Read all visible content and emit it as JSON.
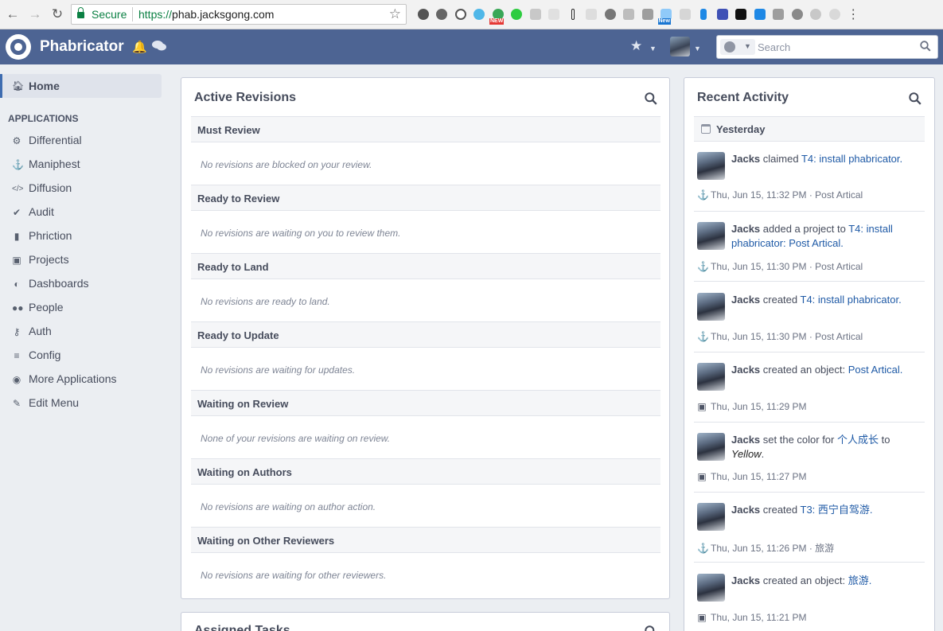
{
  "browser": {
    "secure_label": "Secure",
    "url_protocol": "https://",
    "url_host": "phab.jacksgong.com",
    "extension_badges": [
      "NEW",
      "New"
    ]
  },
  "topbar": {
    "app_name": "Phabricator",
    "search_placeholder": "Search",
    "brand_color": "#4d6493"
  },
  "sidebar": {
    "home_label": "Home",
    "applications_header": "APPLICATIONS",
    "items": [
      {
        "label": "Differential",
        "icon": "gear-icon"
      },
      {
        "label": "Maniphest",
        "icon": "anchor-icon"
      },
      {
        "label": "Diffusion",
        "icon": "code-icon"
      },
      {
        "label": "Audit",
        "icon": "check-circle-icon"
      },
      {
        "label": "Phriction",
        "icon": "book-icon"
      },
      {
        "label": "Projects",
        "icon": "briefcase-icon"
      },
      {
        "label": "Dashboards",
        "icon": "dashboard-icon"
      },
      {
        "label": "People",
        "icon": "users-icon"
      },
      {
        "label": "Auth",
        "icon": "key-icon"
      },
      {
        "label": "Config",
        "icon": "sliders-icon"
      },
      {
        "label": "More Applications",
        "icon": "globe-icon"
      },
      {
        "label": "Edit Menu",
        "icon": "pencil-icon"
      }
    ]
  },
  "active_revisions": {
    "title": "Active Revisions",
    "sections": [
      {
        "header": "Must Review",
        "empty": "No revisions are blocked on your review."
      },
      {
        "header": "Ready to Review",
        "empty": "No revisions are waiting on you to review them."
      },
      {
        "header": "Ready to Land",
        "empty": "No revisions are ready to land."
      },
      {
        "header": "Ready to Update",
        "empty": "No revisions are waiting for updates."
      },
      {
        "header": "Waiting on Review",
        "empty": "None of your revisions are waiting on review."
      },
      {
        "header": "Waiting on Authors",
        "empty": "No revisions are waiting on author action."
      },
      {
        "header": "Waiting on Other Reviewers",
        "empty": "No revisions are waiting for other reviewers."
      }
    ]
  },
  "assigned_tasks": {
    "title": "Assigned Tasks"
  },
  "recent_activity": {
    "title": "Recent Activity",
    "day": "Yesterday",
    "stories": [
      {
        "user": "Jacks",
        "action": " claimed ",
        "link": "T4: install phabricator.",
        "after_link": "",
        "meta": "Thu, Jun 15, 11:32 PM · Post Artical",
        "meta_icon": "anchor-icon"
      },
      {
        "user": "Jacks",
        "action": " added a project to ",
        "link": "T4: install phabricator: Post Artical.",
        "after_link": "",
        "meta": "Thu, Jun 15, 11:30 PM · Post Artical",
        "meta_icon": "anchor-icon"
      },
      {
        "user": "Jacks",
        "action": " created ",
        "link": "T4: install phabricator.",
        "after_link": "",
        "meta": "Thu, Jun 15, 11:30 PM · Post Artical",
        "meta_icon": "anchor-icon"
      },
      {
        "user": "Jacks",
        "action": " created an object: ",
        "link": "Post Artical.",
        "after_link": "",
        "meta": "Thu, Jun 15, 11:29 PM",
        "meta_icon": "briefcase-icon"
      },
      {
        "user": "Jacks",
        "action": " set the color for ",
        "link": "个人成长",
        "after_link": " to ",
        "emph": "Yellow",
        "tail": ".",
        "meta": "Thu, Jun 15, 11:27 PM",
        "meta_icon": "briefcase-icon"
      },
      {
        "user": "Jacks",
        "action": " created ",
        "link": "T3: 西宁自驾游.",
        "after_link": "",
        "meta": "Thu, Jun 15, 11:26 PM · 旅游",
        "meta_icon": "anchor-icon"
      },
      {
        "user": "Jacks",
        "action": " created an object: ",
        "link": "旅游.",
        "after_link": "",
        "meta": "Thu, Jun 15, 11:21 PM",
        "meta_icon": "briefcase-icon"
      }
    ]
  }
}
